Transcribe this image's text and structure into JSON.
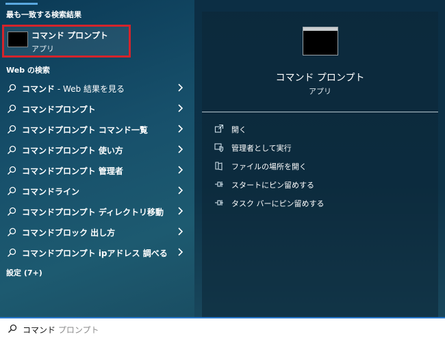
{
  "best_match": {
    "heading": "最も一致する検索結果",
    "title": "コマンド プロンプト",
    "subtitle": "アプリ",
    "icon": "command-prompt-icon"
  },
  "web_search": {
    "heading": "Web の検索",
    "results": [
      {
        "bold": "コマンド",
        "suffix": " - Web 結果を見る"
      },
      {
        "bold": "コマンドプロンプト",
        "suffix": ""
      },
      {
        "bold": "コマンドプロンプト コマンド一覧",
        "suffix": ""
      },
      {
        "bold": "コマンドプロンプト 使い方",
        "suffix": ""
      },
      {
        "bold": "コマンドプロンプト 管理者",
        "suffix": ""
      },
      {
        "bold": "コマンドライン",
        "suffix": ""
      },
      {
        "bold": "コマンドプロンプト ディレクトリ移動",
        "suffix": ""
      },
      {
        "bold": "コマンドブロック 出し方",
        "suffix": ""
      },
      {
        "bold": "コマンドプロンプト ipアドレス 調べる",
        "suffix": ""
      }
    ]
  },
  "settings": {
    "label": "設定 (7+)"
  },
  "preview": {
    "title": "コマンド プロンプト",
    "subtitle": "アプリ",
    "actions": [
      {
        "label": "開く",
        "icon": "open-icon"
      },
      {
        "label": "管理者として実行",
        "icon": "shield-icon"
      },
      {
        "label": "ファイルの場所を開く",
        "icon": "folder-icon"
      },
      {
        "label": "スタートにピン留めする",
        "icon": "pin-icon"
      },
      {
        "label": "タスク バーにピン留めする",
        "icon": "pin-icon"
      }
    ]
  },
  "search": {
    "typed": "コマンド",
    "suggestion": " プロンプト"
  },
  "colors": {
    "accent": "#2b7bd0",
    "highlight_border": "#d5242b"
  }
}
